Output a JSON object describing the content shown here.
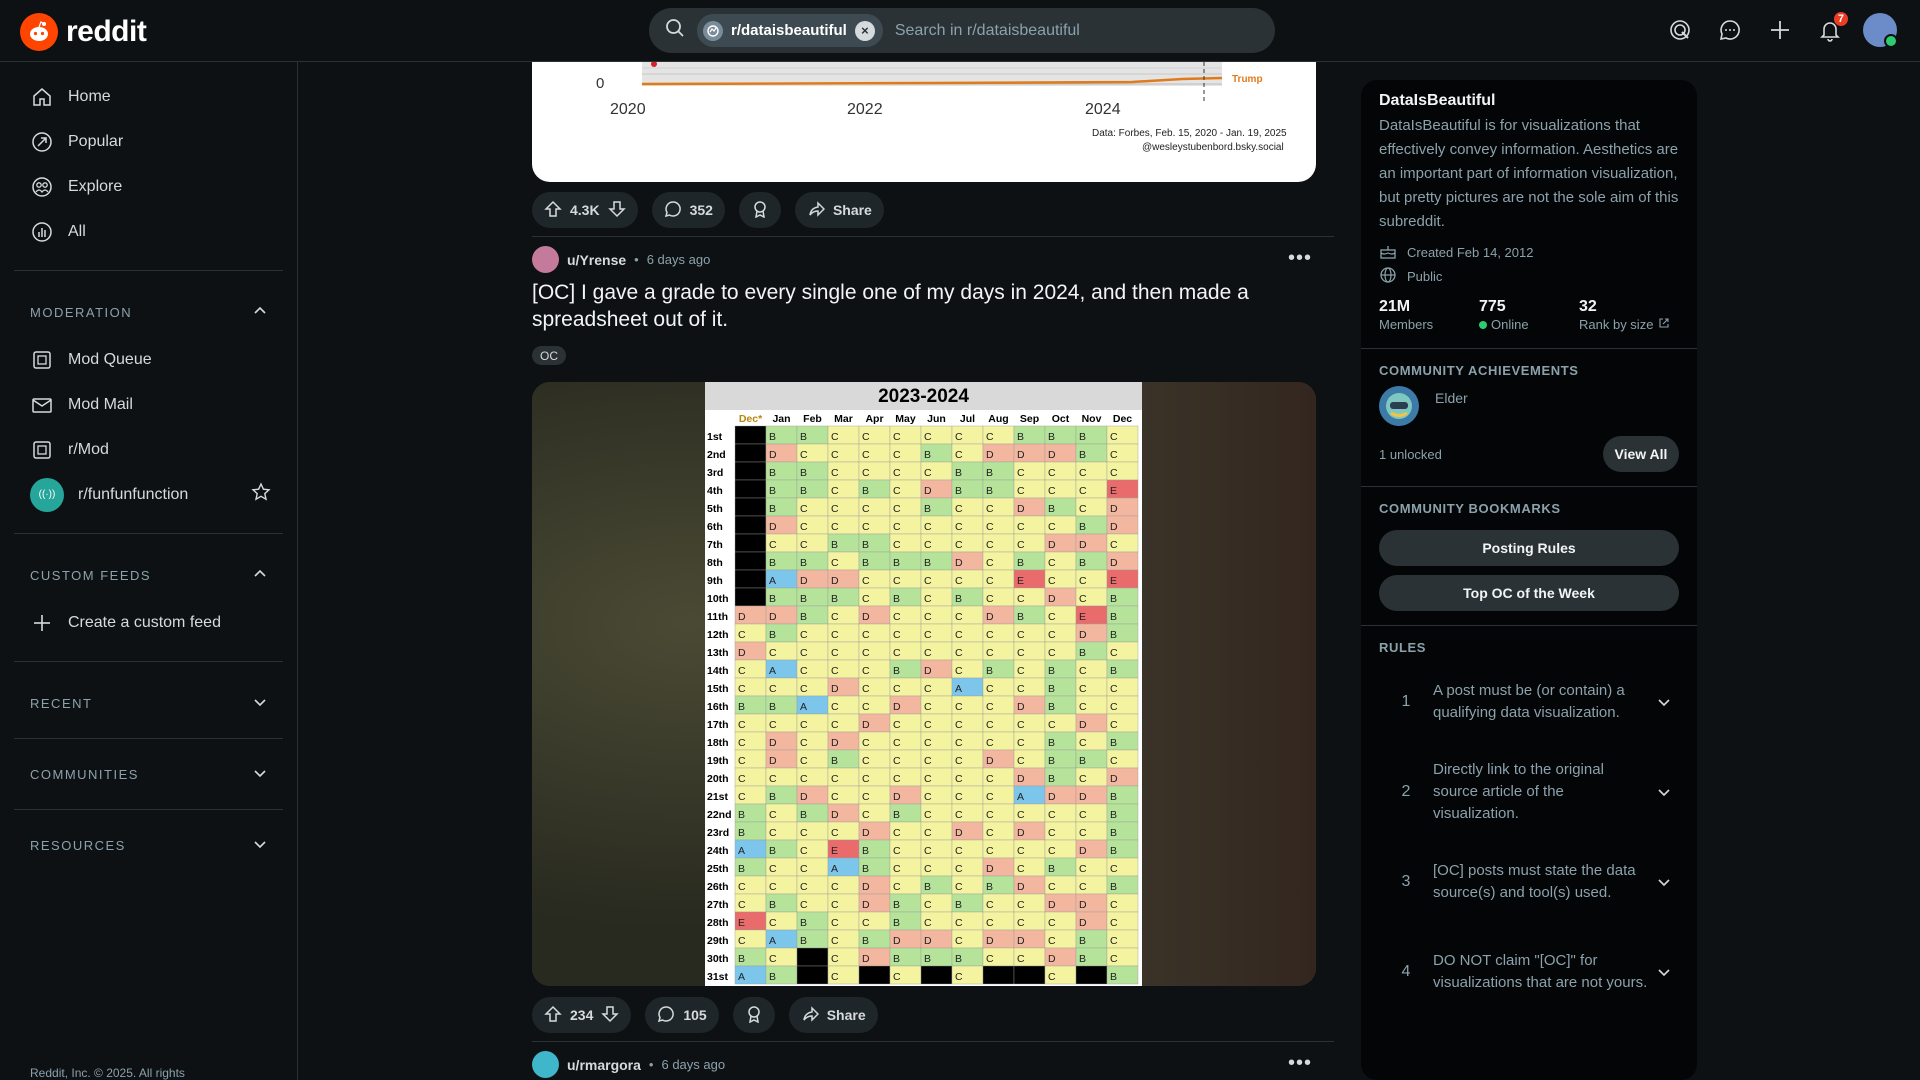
{
  "topbar": {
    "logo_text": "reddit",
    "search_chip": "r/dataisbeautiful",
    "search_placeholder": "Search in r/dataisbeautiful",
    "notification_count": "7"
  },
  "sidebar": {
    "nav": [
      {
        "label": "Home",
        "icon": "home-icon"
      },
      {
        "label": "Popular",
        "icon": "popular-icon"
      },
      {
        "label": "Explore",
        "icon": "explore-icon"
      },
      {
        "label": "All",
        "icon": "all-icon"
      }
    ],
    "moderation": {
      "title": "MODERATION",
      "items": [
        {
          "label": "Mod Queue",
          "icon": "mod-queue-icon"
        },
        {
          "label": "Mod Mail",
          "icon": "mod-mail-icon"
        },
        {
          "label": "r/Mod",
          "icon": "mod-icon"
        },
        {
          "label": "r/funfunfunction",
          "icon": "community-avatar"
        }
      ]
    },
    "custom_feeds": {
      "title": "CUSTOM FEEDS",
      "create_label": "Create a custom feed"
    },
    "recent": "RECENT",
    "communities": "COMMUNITIES",
    "resources": "RESOURCES",
    "footer": "Reddit, Inc. © 2025. All rights"
  },
  "prev_post": {
    "axis_zero": "0",
    "years": [
      "2020",
      "2022",
      "2024"
    ],
    "series_label": "Trump",
    "source": "Data: Forbes, Feb. 15, 2020 - Jan. 19, 2025",
    "credit": "@wesleystubenbord.bsky.social",
    "votes": "4.3K",
    "comments": "352",
    "share": "Share"
  },
  "post": {
    "user": "u/Yrense",
    "time": "6 days ago",
    "title": "[OC] I gave a grade to every single one of my days in 2024, and then made a spreadsheet out of it.",
    "flair": "OC",
    "votes": "234",
    "comments": "105",
    "share": "Share"
  },
  "next_post": {
    "user": "u/rmargora",
    "time": "6 days ago"
  },
  "spreadsheet": {
    "title": "2023-2024",
    "columns": [
      "Dec*",
      "Jan",
      "Feb",
      "Mar",
      "Apr",
      "May",
      "Jun",
      "Jul",
      "Aug",
      "Sep",
      "Oct",
      "Nov",
      "Dec"
    ],
    "rows": [
      {
        "day": "1st",
        "cells": [
          "",
          "B",
          "B",
          "C",
          "C",
          "C",
          "C",
          "C",
          "C",
          "B",
          "B",
          "B",
          "C"
        ]
      },
      {
        "day": "2nd",
        "cells": [
          "",
          "D",
          "C",
          "C",
          "C",
          "C",
          "B",
          "C",
          "D",
          "D",
          "D",
          "B",
          "C"
        ]
      },
      {
        "day": "3rd",
        "cells": [
          "",
          "B",
          "B",
          "C",
          "C",
          "C",
          "C",
          "B",
          "B",
          "C",
          "C",
          "C",
          "C"
        ]
      },
      {
        "day": "4th",
        "cells": [
          "",
          "B",
          "B",
          "C",
          "B",
          "C",
          "D",
          "B",
          "B",
          "C",
          "C",
          "C",
          "E"
        ]
      },
      {
        "day": "5th",
        "cells": [
          "",
          "B",
          "C",
          "C",
          "C",
          "C",
          "B",
          "C",
          "C",
          "D",
          "B",
          "C",
          "D"
        ]
      },
      {
        "day": "6th",
        "cells": [
          "",
          "D",
          "C",
          "C",
          "C",
          "C",
          "C",
          "C",
          "C",
          "C",
          "C",
          "B",
          "D"
        ]
      },
      {
        "day": "7th",
        "cells": [
          "",
          "C",
          "C",
          "B",
          "B",
          "C",
          "C",
          "C",
          "C",
          "C",
          "D",
          "D",
          "C"
        ]
      },
      {
        "day": "8th",
        "cells": [
          "",
          "B",
          "B",
          "C",
          "B",
          "B",
          "B",
          "D",
          "C",
          "B",
          "C",
          "B",
          "D"
        ]
      },
      {
        "day": "9th",
        "cells": [
          "",
          "A",
          "D",
          "D",
          "C",
          "C",
          "C",
          "C",
          "C",
          "E",
          "C",
          "C",
          "E"
        ]
      },
      {
        "day": "10th",
        "cells": [
          "",
          "B",
          "B",
          "B",
          "C",
          "B",
          "C",
          "B",
          "C",
          "C",
          "D",
          "C",
          "B"
        ]
      },
      {
        "day": "11th",
        "cells": [
          "D",
          "D",
          "B",
          "C",
          "D",
          "C",
          "C",
          "C",
          "D",
          "B",
          "C",
          "E",
          "B"
        ]
      },
      {
        "day": "12th",
        "cells": [
          "C",
          "B",
          "C",
          "C",
          "C",
          "C",
          "C",
          "C",
          "C",
          "C",
          "C",
          "D",
          "B"
        ]
      },
      {
        "day": "13th",
        "cells": [
          "D",
          "C",
          "C",
          "C",
          "C",
          "C",
          "C",
          "C",
          "C",
          "C",
          "C",
          "B",
          "C"
        ]
      },
      {
        "day": "14th",
        "cells": [
          "C",
          "A",
          "C",
          "C",
          "C",
          "B",
          "D",
          "C",
          "B",
          "C",
          "B",
          "C",
          "B"
        ]
      },
      {
        "day": "15th",
        "cells": [
          "C",
          "C",
          "C",
          "D",
          "C",
          "C",
          "C",
          "A",
          "C",
          "C",
          "B",
          "C",
          "C"
        ]
      },
      {
        "day": "16th",
        "cells": [
          "B",
          "B",
          "A",
          "C",
          "C",
          "D",
          "C",
          "C",
          "C",
          "D",
          "B",
          "C",
          "C"
        ]
      },
      {
        "day": "17th",
        "cells": [
          "C",
          "C",
          "C",
          "C",
          "D",
          "C",
          "C",
          "C",
          "C",
          "C",
          "C",
          "D",
          "C"
        ]
      },
      {
        "day": "18th",
        "cells": [
          "C",
          "D",
          "C",
          "D",
          "C",
          "C",
          "C",
          "C",
          "C",
          "C",
          "B",
          "C",
          "B"
        ]
      },
      {
        "day": "19th",
        "cells": [
          "C",
          "D",
          "C",
          "B",
          "C",
          "C",
          "C",
          "C",
          "D",
          "C",
          "B",
          "B",
          "C"
        ]
      },
      {
        "day": "20th",
        "cells": [
          "C",
          "C",
          "C",
          "C",
          "C",
          "C",
          "C",
          "C",
          "C",
          "D",
          "B",
          "C",
          "D"
        ]
      },
      {
        "day": "21st",
        "cells": [
          "C",
          "B",
          "D",
          "C",
          "C",
          "D",
          "C",
          "C",
          "C",
          "A",
          "D",
          "D",
          "B"
        ]
      },
      {
        "day": "22nd",
        "cells": [
          "B",
          "C",
          "B",
          "D",
          "C",
          "B",
          "C",
          "C",
          "C",
          "C",
          "C",
          "C",
          "B"
        ]
      },
      {
        "day": "23rd",
        "cells": [
          "B",
          "C",
          "C",
          "C",
          "D",
          "C",
          "C",
          "D",
          "C",
          "D",
          "C",
          "C",
          "B"
        ]
      },
      {
        "day": "24th",
        "cells": [
          "A",
          "B",
          "C",
          "E",
          "B",
          "C",
          "C",
          "C",
          "C",
          "C",
          "C",
          "D",
          "B"
        ]
      },
      {
        "day": "25th",
        "cells": [
          "B",
          "C",
          "C",
          "A",
          "B",
          "C",
          "C",
          "C",
          "D",
          "C",
          "B",
          "C",
          "C"
        ]
      },
      {
        "day": "26th",
        "cells": [
          "C",
          "C",
          "C",
          "C",
          "D",
          "C",
          "B",
          "C",
          "B",
          "D",
          "C",
          "C",
          "B"
        ]
      },
      {
        "day": "27th",
        "cells": [
          "C",
          "B",
          "C",
          "C",
          "D",
          "B",
          "C",
          "B",
          "C",
          "C",
          "D",
          "D",
          "C"
        ]
      },
      {
        "day": "28th",
        "cells": [
          "E",
          "C",
          "B",
          "C",
          "C",
          "B",
          "C",
          "C",
          "C",
          "C",
          "C",
          "D",
          "C"
        ]
      },
      {
        "day": "29th",
        "cells": [
          "C",
          "A",
          "B",
          "C",
          "B",
          "D",
          "D",
          "C",
          "D",
          "D",
          "C",
          "B",
          "C"
        ]
      },
      {
        "day": "30th",
        "cells": [
          "B",
          "C",
          "",
          "C",
          "D",
          "B",
          "B",
          "B",
          "C",
          "C",
          "D",
          "B",
          "C"
        ]
      },
      {
        "day": "31st",
        "cells": [
          "A",
          "B",
          "",
          "C",
          "",
          "C",
          "",
          "C",
          "",
          "",
          "C",
          "",
          "B"
        ]
      }
    ],
    "grade_colors": {
      "A": "#7cc6ec",
      "B": "#b6e39a",
      "C": "#f4f4a0",
      "D": "#f3b7a0",
      "E": "#ea6b6b",
      "": "#000000"
    }
  },
  "community": {
    "name": "DataIsBeautiful",
    "description": "DataIsBeautiful is for visualizations that effectively convey information. Aesthetics are an important part of information visualization, but pretty pictures are not the sole aim of this subreddit.",
    "created": "Created Feb 14, 2012",
    "visibility": "Public",
    "members_value": "21M",
    "members_label": "Members",
    "online_value": "775",
    "online_label": "Online",
    "rank_value": "32",
    "rank_label": "Rank by size",
    "achievements_title": "COMMUNITY ACHIEVEMENTS",
    "achievement_name": "Elder",
    "unlocked": "1 unlocked",
    "view_all": "View All",
    "bookmarks_title": "COMMUNITY BOOKMARKS",
    "bookmarks": [
      "Posting Rules",
      "Top OC of the Week"
    ],
    "rules_title": "RULES",
    "rules": [
      {
        "num": "1",
        "text": "A post must be (or contain) a qualifying data visualization."
      },
      {
        "num": "2",
        "text": "Directly link to the original source article of the visualization."
      },
      {
        "num": "3",
        "text": "[OC] posts must state the data source(s) and tool(s) used."
      },
      {
        "num": "4",
        "text": "DO NOT claim \"[OC]\" for visualizations that are not yours."
      }
    ]
  }
}
